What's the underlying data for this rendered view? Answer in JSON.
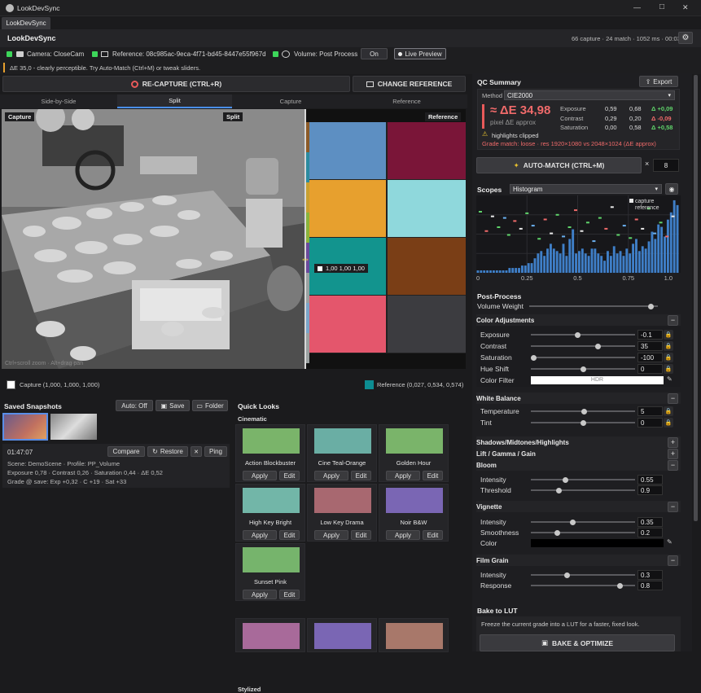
{
  "window": {
    "title": "LookDevSync",
    "tab": "LookDevSync",
    "minimize": "—",
    "maximize": "□",
    "close": "✕"
  },
  "header": {
    "app_title": "LookDevSync",
    "stats": "66 capture · 24 match · 1052 ms · 00:03"
  },
  "toolbar": {
    "camera": "Camera: CloseCam",
    "reference": "Reference: 08c985ac-9eca-4f71-bd45-8447e55f967d",
    "volume": "Volume: Post Process",
    "on_label": "On",
    "live_preview": "Live Preview"
  },
  "hint": {
    "text": "ΔE 35,0 - clearly perceptible. Try Auto-Match (Ctrl+M) or tweak sliders."
  },
  "capture_bar": {
    "recapture": "RE-CAPTURE (CTRL+R)",
    "change_ref": "CHANGE REFERENCE"
  },
  "view_tabs": [
    {
      "label": "Side-by-Side"
    },
    {
      "label": "Split"
    },
    {
      "label": "Capture"
    },
    {
      "label": "Reference"
    }
  ],
  "viewport": {
    "capture_tag": "Capture",
    "split_tag": "Split",
    "reference_tag": "Reference",
    "pixel_readout": "1,00 1,00 1,00",
    "hint": "Ctrl+scroll zoom · Alt+drag pan",
    "split_fraction": 0.5,
    "swatches": [
      "#5d8fc2",
      "#7a1538",
      "#e7a02e",
      "#8fd8dc",
      "#12948e",
      "#7a3e16",
      "#e4566c",
      "#3c3c40"
    ],
    "strip_colors": [
      "#8c5b29",
      "#2c8ba0",
      "#c8a032",
      "#8ab43c",
      "#6b4a9c",
      "#9aa0a0",
      "#7aa4c8",
      "#9aa0a0"
    ]
  },
  "picker": {
    "capture": "Capture (1,000, 1,000, 1,000)",
    "capture_color": "#ffffff",
    "reference": "Reference (0,027, 0,534, 0,574)",
    "reference_color": "#0d8d92"
  },
  "snapshots": {
    "title": "Saved Snapshots",
    "auto": "Auto: Off",
    "save": "Save",
    "folder": "Folder",
    "time": "01:47:07",
    "compare": "Compare",
    "restore": "Restore",
    "x_label": "✕",
    "ping": "Ping",
    "line1": "Scene: DemoScene · Profile: PP_Volume",
    "line2": "Exposure 0,78 · Contrast 0,26 · Saturation 0,44 · ΔE 0,52",
    "line3": "Grade @ save: Exp +0,32 · C +19 · Sat +33"
  },
  "quick_looks": {
    "title": "Quick Looks",
    "cinematic": "Cinematic",
    "stylized": "Stylized",
    "apply": "Apply",
    "edit": "Edit",
    "cards": [
      {
        "name": "Action Blockbuster",
        "color": "#7ab46a"
      },
      {
        "name": "Cine Teal-Orange",
        "color": "#6aaea4"
      },
      {
        "name": "Golden Hour",
        "color": "#7ab46a"
      },
      {
        "name": "High Key Bright",
        "color": "#72b6a8"
      },
      {
        "name": "Low Key Drama",
        "color": "#a86870"
      },
      {
        "name": "Noir B&W",
        "color": "#7a66b4"
      },
      {
        "name": "Sunset Pink",
        "color": "#76b46c"
      }
    ],
    "stylized_colors": [
      "#a86a9a",
      "#7a66b4",
      "#a8786a"
    ]
  },
  "qc": {
    "title": "QC Summary",
    "export": "Export",
    "method_label": "Method",
    "method": "CIE2000",
    "de": "≈ ΔE 34,98",
    "de_sub": "pixel ΔE approx",
    "rows": [
      {
        "name": "Exposure",
        "a": "0,59",
        "b": "0,68",
        "d": "Δ +0,09",
        "dc": "#5fd36a"
      },
      {
        "name": "Contrast",
        "a": "0,29",
        "b": "0,20",
        "d": "Δ -0,09",
        "dc": "#ef6a6a"
      },
      {
        "name": "Saturation",
        "a": "0,00",
        "b": "0,58",
        "d": "Δ +0,58",
        "dc": "#5fd36a"
      }
    ],
    "clipped": "highlights clipped",
    "grade": "Grade match: loose · res 1920×1080 vs 2048×1024 (ΔE approx)"
  },
  "automatch": {
    "label": "AUTO-MATCH (CTRL+M)",
    "x": "×",
    "count": "8"
  },
  "scopes": {
    "title": "Scopes",
    "mode": "Histogram",
    "legend_capture": "capture",
    "legend_reference": "reference",
    "xticks": [
      "0",
      "0.25",
      "0.5",
      "0.75",
      "1.0"
    ]
  },
  "chart_data": {
    "type": "bar",
    "title": "",
    "xlabel": "",
    "ylabel": "",
    "xlim": [
      0,
      1
    ],
    "series": [
      {
        "name": "capture",
        "values": [
          1,
          1,
          1,
          1,
          1,
          1,
          1,
          1,
          1,
          1,
          2,
          2,
          2,
          2,
          3,
          3,
          4,
          4,
          6,
          8,
          9,
          7,
          10,
          12,
          10,
          9,
          8,
          12,
          7,
          14,
          18,
          8,
          9,
          10,
          8,
          7,
          10,
          10,
          8,
          7,
          5,
          9,
          7,
          11,
          8,
          9,
          7,
          10,
          8,
          12,
          14,
          9,
          11,
          10,
          13,
          17,
          14,
          20,
          19,
          15,
          22,
          25,
          30,
          28
        ]
      }
    ],
    "reference_marks": [
      [
        0.02,
        0.8
      ],
      [
        0.05,
        0.55
      ],
      [
        0.08,
        0.74
      ],
      [
        0.11,
        0.6
      ],
      [
        0.14,
        0.72
      ],
      [
        0.16,
        0.5
      ],
      [
        0.19,
        0.68
      ],
      [
        0.22,
        0.58
      ],
      [
        0.25,
        0.78
      ],
      [
        0.28,
        0.62
      ],
      [
        0.31,
        0.45
      ],
      [
        0.34,
        0.7
      ],
      [
        0.37,
        0.52
      ],
      [
        0.4,
        0.76
      ],
      [
        0.43,
        0.48
      ],
      [
        0.46,
        0.6
      ],
      [
        0.49,
        0.82
      ],
      [
        0.52,
        0.55
      ],
      [
        0.55,
        0.66
      ],
      [
        0.58,
        0.42
      ],
      [
        0.61,
        0.72
      ],
      [
        0.64,
        0.58
      ],
      [
        0.67,
        0.86
      ],
      [
        0.7,
        0.5
      ],
      [
        0.73,
        0.62
      ],
      [
        0.76,
        0.46
      ],
      [
        0.79,
        0.7
      ],
      [
        0.82,
        0.58
      ],
      [
        0.85,
        0.84
      ],
      [
        0.88,
        0.52
      ],
      [
        0.91,
        0.66
      ],
      [
        0.94,
        0.48
      ],
      [
        0.97,
        0.74
      ]
    ]
  },
  "postprocess": {
    "title": "Post-Process",
    "volume_weight": "Volume Weight",
    "volume_value": 0.97
  },
  "color_adj": {
    "title": "Color Adjustments",
    "rows": [
      {
        "name": "Exposure",
        "value": "-0.1",
        "pos": 0.45
      },
      {
        "name": "Contrast",
        "value": "35",
        "pos": 0.65
      },
      {
        "name": "Saturation",
        "value": "-100",
        "pos": 0.0
      },
      {
        "name": "Hue Shift",
        "value": "0",
        "pos": 0.5
      }
    ],
    "filter": "Color Filter",
    "filter_value": "HDR"
  },
  "white_balance": {
    "title": "White Balance",
    "rows": [
      {
        "name": "Temperature",
        "value": "5",
        "pos": 0.51
      },
      {
        "name": "Tint",
        "value": "0",
        "pos": 0.5
      }
    ]
  },
  "smh": {
    "title": "Shadows/Midtones/Highlights"
  },
  "lgg": {
    "title": "Lift / Gamma / Gain"
  },
  "bloom": {
    "title": "Bloom",
    "rows": [
      {
        "name": "Intensity",
        "value": "0.55",
        "pos": 0.32
      },
      {
        "name": "Threshold",
        "value": "0.9",
        "pos": 0.26
      }
    ]
  },
  "vignette": {
    "title": "Vignette",
    "rows": [
      {
        "name": "Intensity",
        "value": "0.35",
        "pos": 0.4
      },
      {
        "name": "Smoothness",
        "value": "0.2",
        "pos": 0.24
      }
    ],
    "color": "Color"
  },
  "film_grain": {
    "title": "Film Grain",
    "rows": [
      {
        "name": "Intensity",
        "value": "0.3",
        "pos": 0.34
      },
      {
        "name": "Response",
        "value": "0.8",
        "pos": 0.88
      }
    ]
  },
  "lut": {
    "title": "Bake to LUT",
    "desc": "Freeze the current grade into a LUT for a faster, fixed look.",
    "bake": "BAKE & OPTIMIZE"
  }
}
